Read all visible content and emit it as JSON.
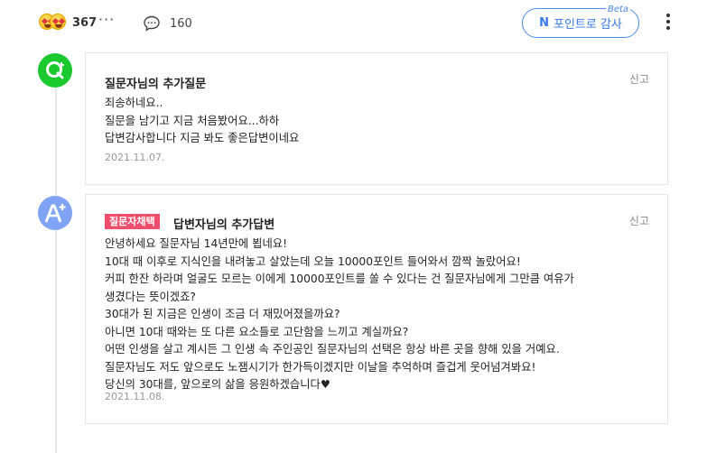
{
  "reactions": {
    "count": "367",
    "more": "···"
  },
  "comments": {
    "count": "160"
  },
  "thanks_button": {
    "icon": "N",
    "label": "포인트로 감사",
    "tag": "Beta"
  },
  "question_card": {
    "title": "질문자님의 추가질문",
    "report": "신고",
    "lines": [
      "죄송하네요..",
      "질문을 남기고 지금 처음봤어요...하하",
      "답변감사합니다 지금 봐도 좋은답변이네요"
    ],
    "date": "2021.11.07."
  },
  "answer_card": {
    "badge": "질문자채택",
    "title": "답변자님의 추가답변",
    "report": "신고",
    "lines": [
      "안녕하세요 질문자님 14년만에 뵙네요!",
      "10대 때 이후로 지식인을 내려놓고 살았는데 오늘 10000포인트 들어와서 깜짝 놀랐어요!",
      "커피 한잔 하라며 얼굴도 모르는 이에게 10000포인트를 쏠 수 있다는 건 질문자님에게 그만큼 여유가",
      "생겼다는 뜻이겠죠?",
      "30대가 된 지금은 인생이 조금 더 재밌어졌을까요?",
      "아니면 10대 때와는 또 다른 요소들로 고단함을 느끼고 계실까요?",
      "어떤 인생을 살고 계시든 그 인생 속 주인공인 질문자님의 선택은 항상 바른 곳을 향해 있을 거예요.",
      "질문자님도 저도 앞으로도 노잼시기가 한가득이겠지만 이날을 추억하며 즐겁게 웃어넘겨봐요!",
      "당신의 30대를, 앞으로의 삶을 응원하겠습니다♥"
    ],
    "date": "2021.11.08."
  }
}
